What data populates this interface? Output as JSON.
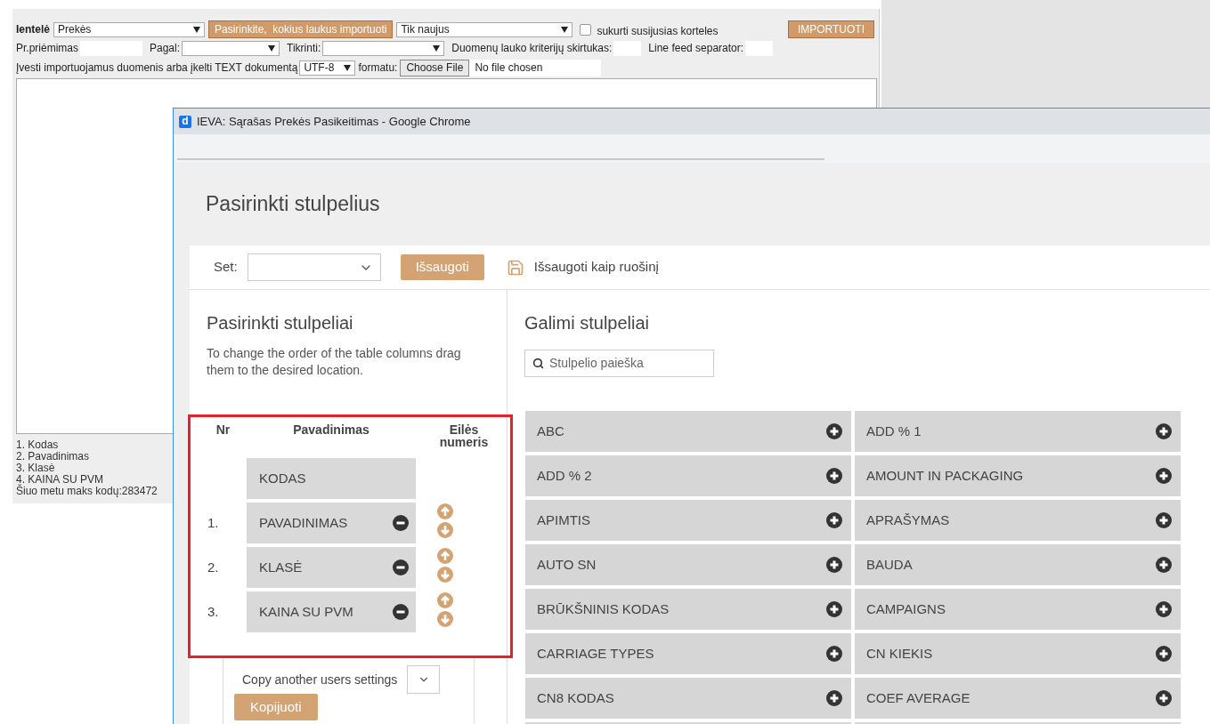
{
  "import_form": {
    "table_label": "Ientelė",
    "table_select": "Prekės",
    "choose_fields_button": "Pasirinkite,  kokius laukus importuoti",
    "mode_select": "Tik naujus",
    "create_cards": {
      "label": "sukurti susijusias korteles",
      "checked": false
    },
    "import_button": "IMPORTUOTI",
    "options": [
      {
        "kind": "input",
        "label": "Pr.priėmimas"
      },
      {
        "kind": "select",
        "label": "Pagal:"
      },
      {
        "kind": "select",
        "label": "Tikrinti:"
      },
      {
        "kind": "input",
        "label": "Duomenų lauko kriterijų skirtukas:"
      },
      {
        "kind": "input",
        "label": "Line feed separator:"
      }
    ],
    "upload_label": "Įvesti importuojamus duomenis arba įkelti TEXT dokumentą",
    "encoding_select": "UTF-8",
    "format_label": "formatu:",
    "file_button": "Choose File",
    "file_status": "No file chosen",
    "field_list": [
      "1. Kodas",
      "2. Pavadinimas",
      "3. Klasė",
      "4. KAINA SU PVM"
    ],
    "max_code": "Šiuo metu maks kodų:283472"
  },
  "popup": {
    "logo_letter": "d",
    "title": "IEVA: Sąrašas Prekės Pasikeitimas - Google Chrome",
    "heading": "Pasirinkti stulpelius",
    "set_label": "Set:",
    "save_button": "Išsaugoti",
    "save_template": "Išsaugoti kaip ruošinį",
    "selected": {
      "heading": "Pasirinkti stulpeliai",
      "hint": "To change the order of the table columns drag them to the desired location.",
      "columns": [
        "Nr",
        "Pavadinimas",
        "Eilės numeris"
      ],
      "fixed_row": "KODAS",
      "rows": [
        {
          "nr": "1.",
          "name": "PAVADINIMAS"
        },
        {
          "nr": "2.",
          "name": "KLASĖ"
        },
        {
          "nr": "3.",
          "name": "KAINA SU PVM"
        }
      ],
      "copy_label": "Copy another users settings",
      "copy_button": "Kopijuoti"
    },
    "available": {
      "heading": "Galimi stulpeliai",
      "search_placeholder": "Stulpelio paieška",
      "items": [
        "ABC",
        "ADD % 1",
        "ADD % 2",
        "AMOUNT IN PACKAGING",
        "APIMTIS",
        "APRAŠYMAS",
        "AUTO SN",
        "BAUDA",
        "BRŪKŠNINIS KODAS",
        "CAMPAIGNS",
        "CARRIAGE TYPES",
        "CN KIEKIS",
        "CN8 KODAS",
        "COEF AVERAGE"
      ]
    }
  }
}
